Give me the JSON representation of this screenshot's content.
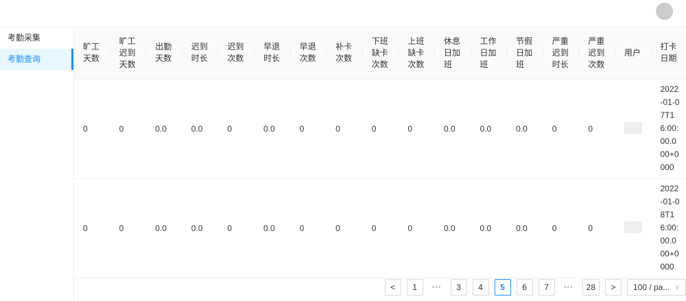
{
  "sidebar": {
    "items": [
      {
        "label": "考勤采集"
      },
      {
        "label": "考勤查询"
      }
    ]
  },
  "table": {
    "columns": [
      "旷工天数",
      "旷工迟到天数",
      "出勤天数",
      "迟到时长",
      "迟到次数",
      "早退时长",
      "早退次数",
      "补卡次数",
      "下班缺卡次数",
      "上班缺卡次数",
      "休息日加班",
      "工作日加班",
      "节假日加班",
      "严重迟到时长",
      "严重迟到次数",
      "用户",
      "打卡日期"
    ],
    "rows": [
      {
        "cells": [
          "0",
          "0",
          "0.0",
          "0.0",
          "0",
          "0.0",
          "0",
          "0",
          "0",
          "0",
          "0.0",
          "0.0",
          "0.0",
          "0",
          "0"
        ],
        "date": "2022-01-07T16:00:00.000+0000"
      },
      {
        "cells": [
          "0",
          "0",
          "0.0",
          "0.0",
          "0",
          "0.0",
          "0",
          "0",
          "0",
          "0",
          "0.0",
          "0.0",
          "0.0",
          "0",
          "0"
        ],
        "date": "2022-01-08T16:00:00.000+0000"
      }
    ]
  },
  "pagination": {
    "prev": "<",
    "next": ">",
    "pages": [
      "1",
      "3",
      "4",
      "5",
      "6",
      "7",
      "28"
    ],
    "current": "5",
    "ellipsis": "•••",
    "page_size": "100 / pa...",
    "chevron": "∨"
  }
}
